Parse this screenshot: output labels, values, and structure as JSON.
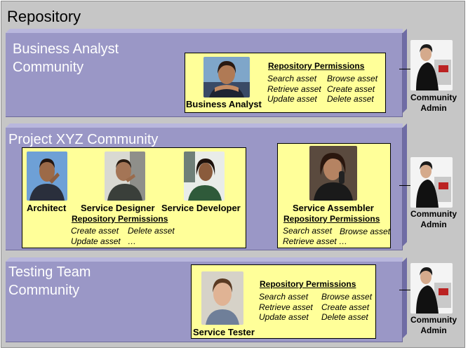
{
  "repository": {
    "title": "Repository"
  },
  "communities": [
    {
      "title": "Business Analyst\nCommunity",
      "roles": [
        "Business Analyst"
      ],
      "permissions_heading": "Repository Permissions",
      "permissions": [
        "Search asset",
        "Browse asset",
        "Retrieve asset",
        "Create asset",
        "Update asset",
        "Delete asset"
      ],
      "admin_label": "Community\nAdmin"
    },
    {
      "title": "Project XYZ Community",
      "groups": [
        {
          "roles": [
            "Architect",
            "Service Designer",
            "Service Developer"
          ],
          "permissions_heading": "Repository Permissions",
          "permissions": [
            "Create asset",
            "Delete asset",
            "Update asset",
            "…"
          ]
        },
        {
          "roles": [
            "Service Assembler"
          ],
          "permissions_heading": "Repository Permissions",
          "permissions": [
            "Search asset",
            "Browse asset",
            "Retrieve asset …"
          ]
        }
      ],
      "admin_label": "Community\nAdmin"
    },
    {
      "title": "Testing Team\nCommunity",
      "roles": [
        "Service Tester"
      ],
      "permissions_heading": "Repository Permissions",
      "permissions": [
        "Search asset",
        "Browse asset",
        "Retrieve asset",
        "Create asset",
        "Update asset",
        "Delete asset"
      ],
      "admin_label": "Community\nAdmin"
    }
  ],
  "colors": {
    "repository_bg": "#c6c6c6",
    "community_bg": "#9a97c6",
    "role_box_bg": "#ffff99"
  }
}
